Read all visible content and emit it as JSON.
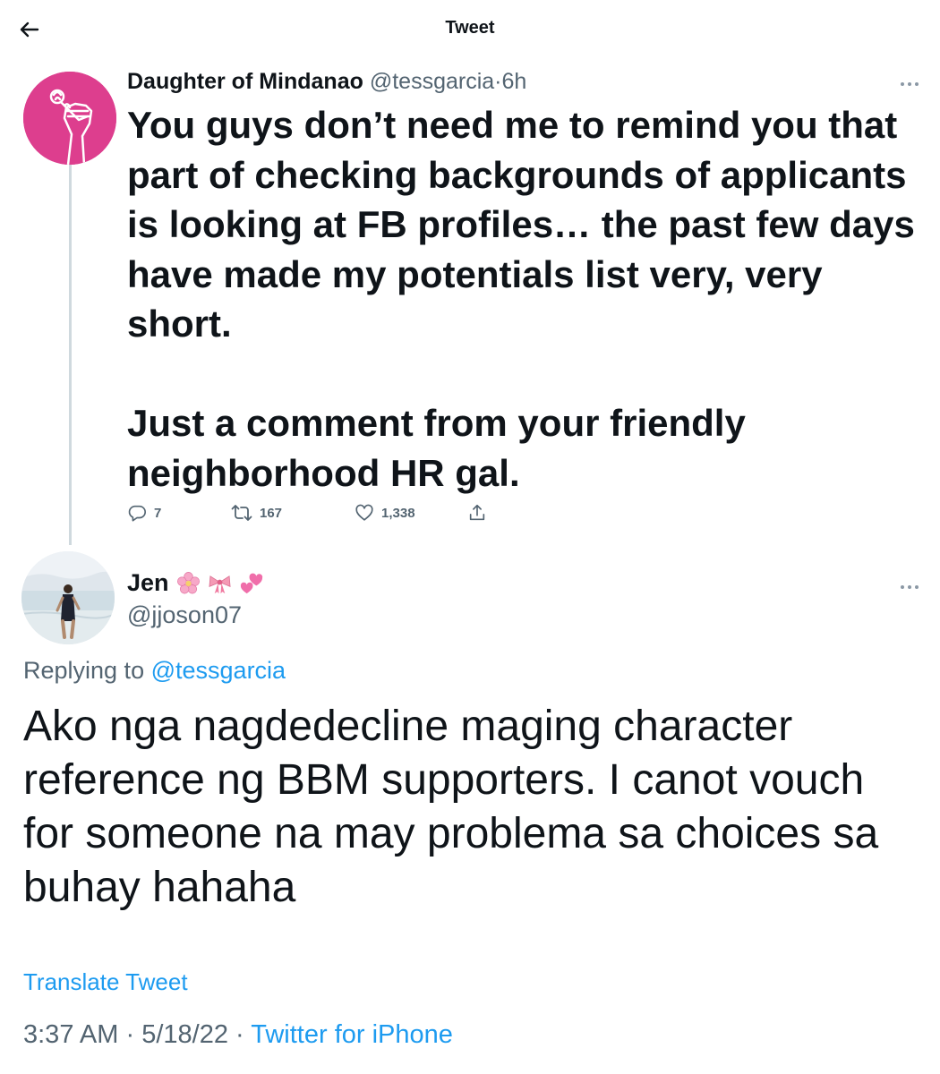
{
  "header": {
    "title": "Tweet",
    "back_icon": "arrow-left-icon"
  },
  "parent_tweet": {
    "display_name": "Daughter of Mindanao",
    "handle": "@tessgarcia",
    "separator": "·",
    "time": "6h",
    "avatar_icon": "raised-fist-with-rose-icon",
    "avatar_color": "#dd3e8e",
    "text": "You guys don’t need me to remind you that part of checking backgrounds of applicants is looking at FB profiles… the past few days have made my potentials list very, very short.\n\nJust a comment from your friendly neighborhood HR gal.",
    "replies_count": "7",
    "retweets_count": "167",
    "likes_count": "1,338"
  },
  "reply_tweet": {
    "display_name": "Jen",
    "emojis": [
      "cherry-blossom-emoji",
      "ribbon-emoji",
      "two-hearts-emoji"
    ],
    "handle": "@jjoson07",
    "replying_prefix": "Replying to",
    "replying_handle": "@tessgarcia",
    "text": "Ako nga nagdedecline maging character reference ng BBM supporters. I canot vouch for someone na may problema sa choices sa buhay hahaha",
    "translate_label": "Translate Tweet",
    "time": "3:37 AM",
    "sep1": "·",
    "date": "5/18/22",
    "sep2": "·",
    "source": "Twitter for iPhone"
  },
  "colors": {
    "text_primary": "#0f1419",
    "text_secondary": "#536471",
    "link": "#1d9bf0",
    "thread_line": "#cfd9de"
  }
}
